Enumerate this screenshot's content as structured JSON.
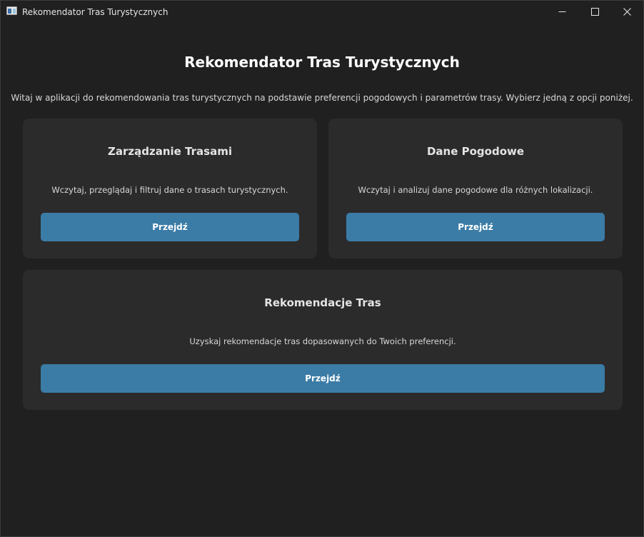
{
  "window": {
    "title": "Rekomendator Tras Turystycznych",
    "icon": "app-window-icon",
    "controls": [
      "minimize-icon",
      "maximize-icon",
      "close-icon"
    ]
  },
  "main": {
    "title": "Rekomendator Tras Turystycznych",
    "intro": "Witaj w aplikacji do rekomendowania tras turystycznych na podstawie preferencji pogodowych i parametrów trasy. Wybierz jedną z opcji poniżej."
  },
  "cards": [
    {
      "title": "Zarządzanie Trasami",
      "description": "Wczytaj, przeglądaj i filtruj dane o trasach turystycznych.",
      "button_label": "Przejdź"
    },
    {
      "title": "Dane Pogodowe",
      "description": "Wczytaj i analizuj dane pogodowe dla różnych lokalizacji.",
      "button_label": "Przejdź"
    },
    {
      "title": "Rekomendacje Tras",
      "description": "Uzyskaj rekomendacje tras dopasowanych do Twoich preferencji.",
      "button_label": "Przejdź"
    }
  ],
  "colors": {
    "background": "#202020",
    "card": "#2b2b2b",
    "button": "#3b7ca6",
    "text": "#ffffff"
  }
}
